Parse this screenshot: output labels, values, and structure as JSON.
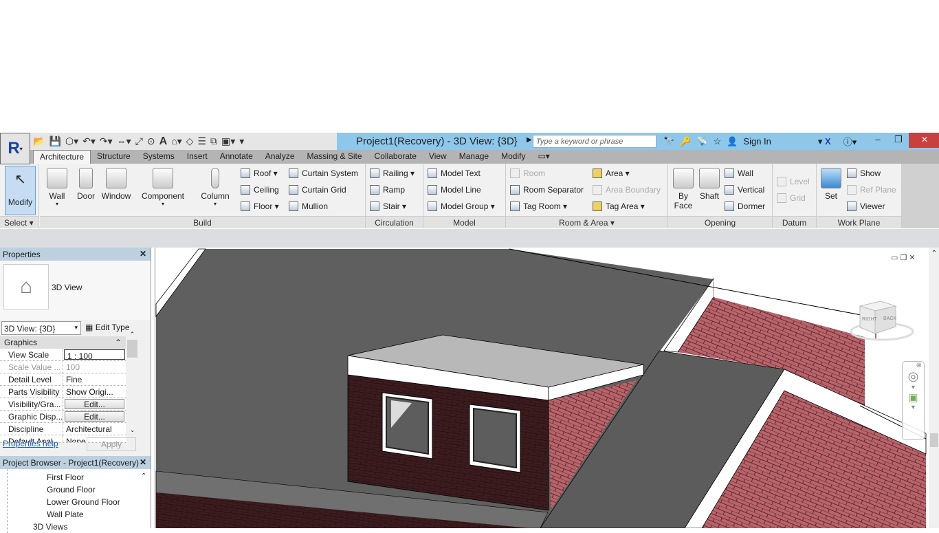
{
  "title": "Project1(Recovery) - 3D View: {3D}",
  "search_placeholder": "Type a keyword or phrase",
  "sign_in": "Sign In",
  "tabs": [
    "Architecture",
    "Structure",
    "Systems",
    "Insert",
    "Annotate",
    "Analyze",
    "Massing & Site",
    "Collaborate",
    "View",
    "Manage",
    "Modify"
  ],
  "ribbon": {
    "select": {
      "button": "Modify",
      "label": "Select ▾"
    },
    "build": {
      "label": "Build",
      "big": [
        "Wall",
        "Door",
        "Window",
        "Component",
        "Column"
      ],
      "small": [
        "Roof ▾",
        "Ceiling",
        "Floor ▾",
        "Curtain System",
        "Curtain Grid",
        "Mullion"
      ]
    },
    "circulation": {
      "label": "Circulation",
      "small": [
        "Railing ▾",
        "Ramp",
        "Stair ▾"
      ]
    },
    "model": {
      "label": "Model",
      "small": [
        "Model Text",
        "Model Line",
        "Model Group ▾"
      ]
    },
    "room_area": {
      "label": "Room & Area ▾",
      "small": [
        "Room",
        "Room Separator",
        "Tag Room ▾",
        "Area ▾",
        "Area Boundary",
        "Tag Area ▾"
      ]
    },
    "opening": {
      "label": "Opening",
      "big": [
        "By Face",
        "Shaft"
      ],
      "small": [
        "Wall",
        "Vertical",
        "Dormer"
      ]
    },
    "datum": {
      "label": "Datum",
      "small": [
        "Level",
        "Grid"
      ]
    },
    "work_plane": {
      "label": "Work Plane",
      "big": [
        "Set"
      ],
      "small": [
        "Show",
        "Ref Plane",
        "Viewer"
      ]
    }
  },
  "properties": {
    "title": "Properties",
    "type_name": "3D View",
    "selector": "3D View: {3D}",
    "edit_type": "Edit Type",
    "group": "Graphics",
    "rows": [
      {
        "k": "View Scale",
        "v": "1 : 100"
      },
      {
        "k": "Scale Value ...",
        "v": "100"
      },
      {
        "k": "Detail Level",
        "v": "Fine"
      },
      {
        "k": "Parts Visibility",
        "v": "Show Origi..."
      },
      {
        "k": "Visibility/Gra...",
        "v": "Edit..."
      },
      {
        "k": "Graphic Disp...",
        "v": "Edit..."
      },
      {
        "k": "Discipline",
        "v": "Architectural"
      },
      {
        "k": "Default Anal...",
        "v": "None"
      }
    ],
    "help": "Properties help",
    "apply": "Apply"
  },
  "browser": {
    "title": "Project Browser - Project1(Recovery)",
    "items": [
      "First Floor",
      "Ground Floor",
      "Lower Ground Floor",
      "Wall Plate",
      "3D Views"
    ]
  },
  "viewcube": {
    "faces": [
      "RIGHT",
      "BACK"
    ]
  }
}
